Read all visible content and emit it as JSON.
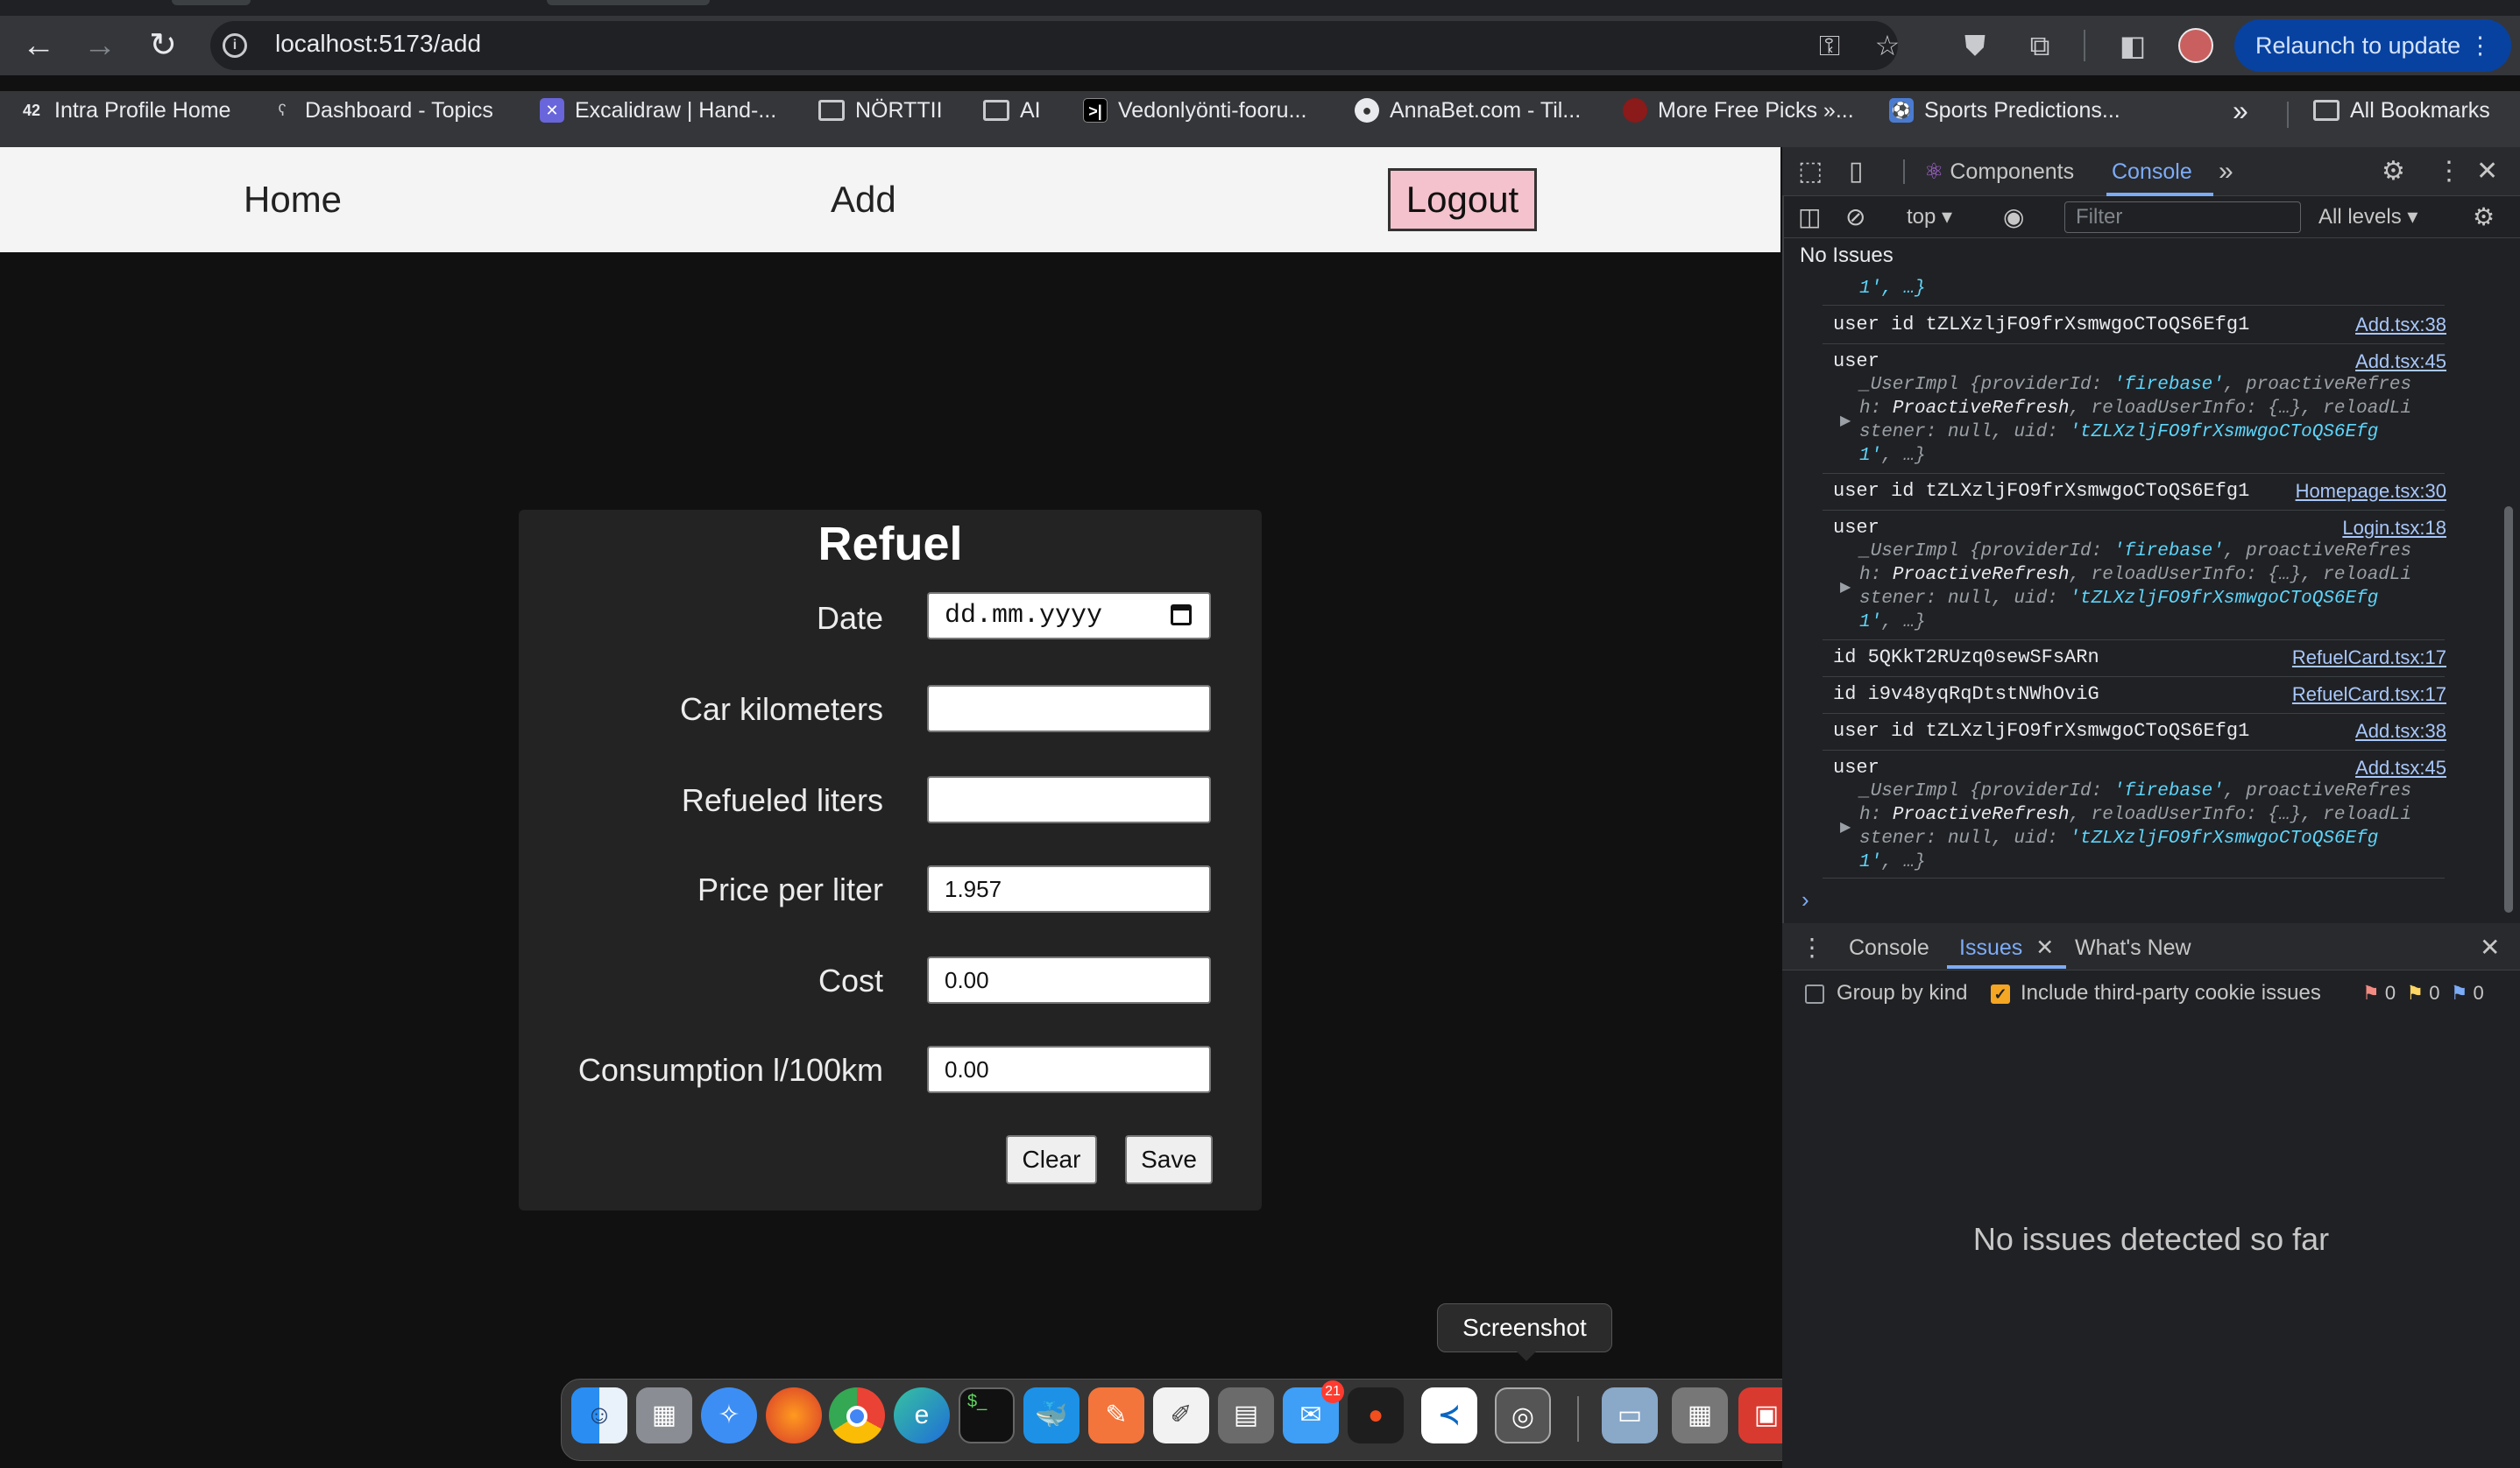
{
  "browser": {
    "url": "localhost:5173/add",
    "relaunch_label": "Relaunch to update",
    "bookmarks": [
      "Intra Profile Home",
      "Dashboard - Topics",
      "Excalidraw | Hand-...",
      "NÖRTTII",
      "AI",
      "Vedonlyönti-fooru...",
      "AnnaBet.com - Til...",
      "More Free Picks »...",
      "Sports Predictions..."
    ],
    "all_bookmarks": "All Bookmarks",
    "more_glyph": "»"
  },
  "app": {
    "nav": {
      "home": "Home",
      "add": "Add",
      "logout": "Logout"
    },
    "form": {
      "title": "Refuel",
      "fields": [
        {
          "label": "Date",
          "value": "dd.mm.yyyy"
        },
        {
          "label": "Car kilometers",
          "value": ""
        },
        {
          "label": "Refueled liters",
          "value": ""
        },
        {
          "label": "Price per liter",
          "value": "1.957"
        },
        {
          "label": "Cost",
          "value": "0.00"
        },
        {
          "label": "Consumption l/100km",
          "value": "0.00"
        }
      ],
      "clear_label": "Clear",
      "save_label": "Save"
    }
  },
  "devtools": {
    "tabs": {
      "components": "Components",
      "console": "Console"
    },
    "context": "top",
    "filter_placeholder": "Filter",
    "levels": "All levels",
    "no_issues": "No Issues",
    "log_tail": "1', …}",
    "logs": [
      {
        "text": "user id tZLXzljFO9frXsmwgoCToQS6Efg1",
        "source": "Add.tsx:38"
      },
      {
        "text": "user",
        "source": "Add.tsx:45"
      },
      {
        "text": "user id tZLXzljFO9frXsmwgoCToQS6Efg1",
        "source": "Homepage.tsx:30"
      },
      {
        "text": "user",
        "source": "Login.tsx:18"
      },
      {
        "text": "id 5QKkT2RUzq0sewSFsARn",
        "source": "RefuelCard.tsx:17"
      },
      {
        "text": "id i9v48yqRqDtstNWhOviG",
        "source": "RefuelCard.tsx:17"
      },
      {
        "text": "user id tZLXzljFO9frXsmwgoCToQS6Efg1",
        "source": "Add.tsx:38"
      },
      {
        "text": "user",
        "source": "Add.tsx:45"
      }
    ],
    "obj": {
      "l1a": "_UserImpl {providerId: ",
      "l1b": "'firebase'",
      "l1c": ", proactiveRefres",
      "l2a": "h: ",
      "l2b": "ProactiveRefresh",
      "l2c": ", reloadUserInfo: {…}, reloadLi",
      "l3a": "stener: null, uid: ",
      "l3b": "'tZLXzljFO9frXsmwgoCToQS6Efg",
      "l4": "1'",
      "l4b": ", …}"
    },
    "drawer": {
      "console": "Console",
      "issues": "Issues",
      "whats_new": "What's New",
      "group_by_kind": "Group by kind",
      "third_party": "Include third-party cookie issues",
      "counts": [
        "0",
        "0",
        "0"
      ],
      "empty": "No issues detected so far"
    }
  },
  "dock": {
    "tooltip": "Screenshot",
    "mail_badge": "21",
    "icons": [
      "finder-icon",
      "launchpad-icon",
      "safari-icon",
      "firefox-icon",
      "chrome-icon",
      "edge-icon",
      "terminal-icon",
      "docker-icon",
      "sublime-icon",
      "textedit-icon",
      "calculator-icon",
      "mail-icon",
      "figma-icon",
      "vscode-icon",
      "screenshot-icon",
      "preview-icon",
      "photo-booth-icon",
      "app-icon",
      "window-icon",
      "trash-icon"
    ]
  },
  "colors": {
    "accent": "#7cacf8",
    "logout_bg": "#f4c2cc",
    "relaunch_bg": "#0842a0"
  }
}
